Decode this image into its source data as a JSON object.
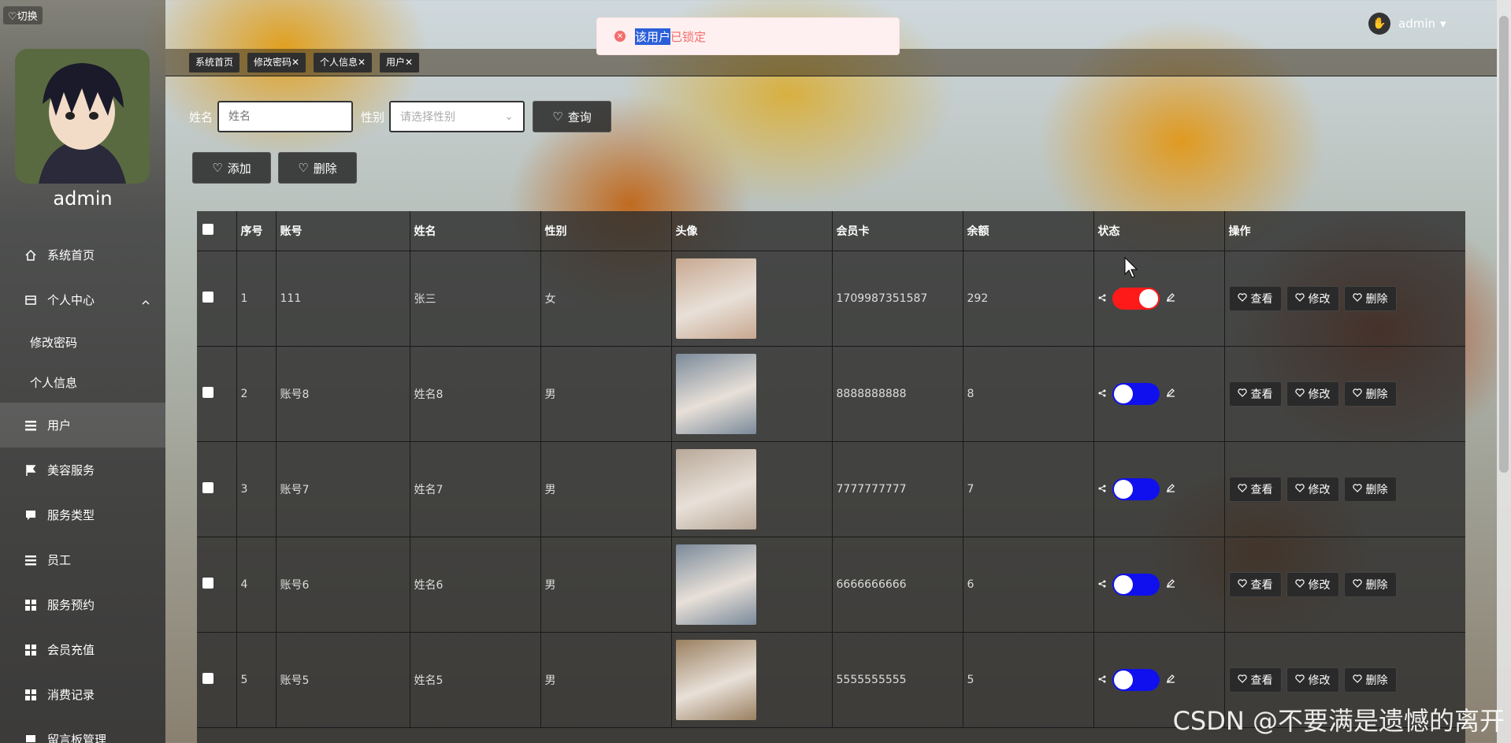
{
  "sidebar": {
    "switch_label": "♡切换",
    "username": "admin",
    "menu": [
      {
        "label": "系统首页",
        "icon": "home-icon"
      },
      {
        "label": "个人中心",
        "icon": "card-icon",
        "expanded": true,
        "children": [
          "修改密码",
          "个人信息"
        ]
      },
      {
        "label": "用户",
        "icon": "list-icon",
        "active": true
      },
      {
        "label": "美容服务",
        "icon": "flag-icon"
      },
      {
        "label": "服务类型",
        "icon": "chat-icon"
      },
      {
        "label": "员工",
        "icon": "list-icon"
      },
      {
        "label": "服务预约",
        "icon": "grid-icon"
      },
      {
        "label": "会员充值",
        "icon": "grid-icon"
      },
      {
        "label": "消费记录",
        "icon": "grid-icon"
      },
      {
        "label": "留言板管理",
        "icon": "monitor-icon"
      }
    ]
  },
  "topbar": {
    "username": "admin"
  },
  "toast": {
    "selected": "该用户",
    "rest": "已锁定",
    "type": "error"
  },
  "tags": [
    "系统首页",
    "修改密码✕",
    "个人信息✕",
    "用户✕"
  ],
  "filters": {
    "name_label": "姓名",
    "name_placeholder": "姓名",
    "gender_label": "性别",
    "gender_placeholder": "请选择性别",
    "query_label": "查询"
  },
  "actions": {
    "add_label": "添加",
    "delete_label": "删除"
  },
  "table": {
    "headers": [
      "",
      "序号",
      "账号",
      "姓名",
      "性别",
      "头像",
      "会员卡",
      "余额",
      "状态",
      "操作"
    ],
    "rows": [
      {
        "no": "1",
        "account": "111",
        "name": "张三",
        "gender": "女",
        "card": "1709987351587",
        "balance": "292",
        "locked": true,
        "photo_color": "#c8a890"
      },
      {
        "no": "2",
        "account": "账号8",
        "name": "姓名8",
        "gender": "男",
        "card": "8888888888",
        "balance": "8",
        "locked": false,
        "photo_color": "#7a8a9a"
      },
      {
        "no": "3",
        "account": "账号7",
        "name": "姓名7",
        "gender": "男",
        "card": "7777777777",
        "balance": "7",
        "locked": false,
        "photo_color": "#b8a898"
      },
      {
        "no": "4",
        "account": "账号6",
        "name": "姓名6",
        "gender": "男",
        "card": "6666666666",
        "balance": "6",
        "locked": false,
        "photo_color": "#7a8a9a"
      },
      {
        "no": "5",
        "account": "账号5",
        "name": "姓名5",
        "gender": "男",
        "card": "5555555555",
        "balance": "5",
        "locked": false,
        "photo_color": "#9a8060"
      }
    ],
    "op_labels": {
      "view": "查看",
      "edit": "修改",
      "delete": "删除"
    }
  },
  "colors": {
    "toggle_on": "#ff1a1a",
    "toggle_off": "#1010ee",
    "toast_text": "#f56c6c"
  },
  "watermark": "CSDN @不要满是遗憾的离开"
}
